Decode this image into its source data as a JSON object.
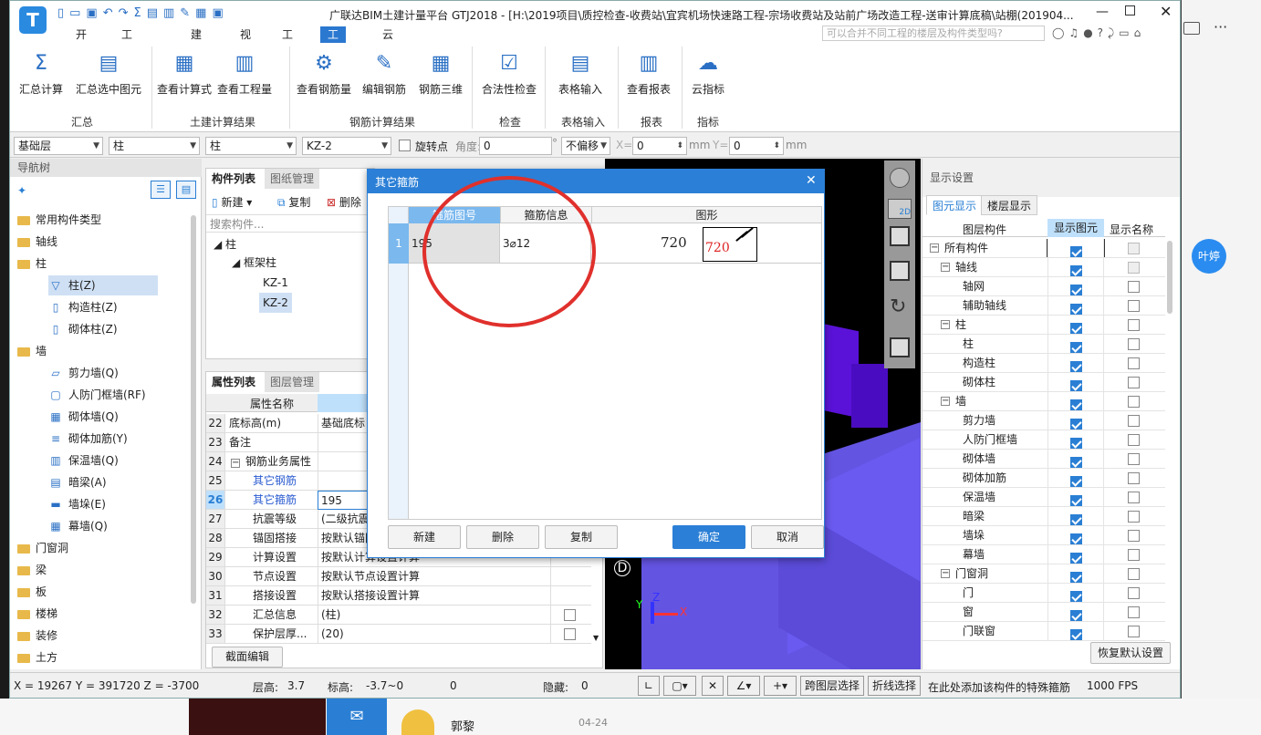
{
  "window": {
    "title": "广联达BIM土建计量平台 GTJ2018 - [H:\\2019项目\\质控检查-收费站\\宜宾机场快速路工程-宗场收费站及站前广场改造工程-送审计算底稿\\站棚(201904..."
  },
  "menu": {
    "tabs": [
      "开始",
      "工程设置",
      "建模",
      "视图",
      "工具",
      "工程量",
      "云应用"
    ],
    "active": 5,
    "search_placeholder": "可以合并不同工程的楼层及构件类型吗?"
  },
  "ribbon": {
    "buttons": [
      "汇总计算",
      "汇总选中图元",
      "查看计算式",
      "查看工程量",
      "查看钢筋量",
      "编辑钢筋",
      "钢筋三维",
      "合法性检查",
      "表格输入",
      "查看报表",
      "云指标"
    ],
    "groups": [
      "汇总",
      "土建计算结果",
      "钢筋计算结果",
      "检查",
      "表格输入",
      "报表",
      "指标"
    ]
  },
  "toolbar": {
    "floor": "基础层",
    "type1": "柱",
    "type2": "柱",
    "comp": "KZ-2",
    "rotate_label": "旋转点",
    "angle_label": "角度:",
    "angle_val": "0",
    "deg": "°",
    "offset": "不偏移",
    "x_label": "X=",
    "x_val": "0",
    "mm1": "mm",
    "y_label": "Y=",
    "y_val": "0",
    "mm2": "mm"
  },
  "nav": {
    "title": "导航树",
    "items": [
      "常用构件类型",
      "轴线",
      "柱",
      "柱(Z)",
      "构造柱(Z)",
      "砌体柱(Z)",
      "墙",
      "剪力墙(Q)",
      "人防门框墙(RF)",
      "砌体墙(Q)",
      "砌体加筋(Y)",
      "保温墙(Q)",
      "暗梁(A)",
      "墙垛(E)",
      "幕墙(Q)",
      "门窗洞",
      "梁",
      "板",
      "楼梯",
      "装修",
      "土方"
    ]
  },
  "complist": {
    "tabs": [
      "构件列表",
      "图纸管理"
    ],
    "new": "新建",
    "copy": "复制",
    "del": "删除",
    "search": "搜索构件...",
    "tree": [
      "柱",
      "框架柱",
      "KZ-1",
      "KZ-2"
    ]
  },
  "props": {
    "tabs": [
      "属性列表",
      "图层管理"
    ],
    "header": "属性名称",
    "rows": [
      [
        "22",
        "底标高(m)",
        "基础底标"
      ],
      [
        "23",
        "备注",
        ""
      ],
      [
        "24",
        "钢筋业务属性",
        ""
      ],
      [
        "25",
        "其它钢筋",
        ""
      ],
      [
        "26",
        "其它箍筋",
        "195"
      ],
      [
        "27",
        "抗震等级",
        "(二级抗震"
      ],
      [
        "28",
        "锚固搭接",
        "按默认锚固"
      ],
      [
        "29",
        "计算设置",
        "按默认计算设置计算"
      ],
      [
        "30",
        "节点设置",
        "按默认节点设置计算"
      ],
      [
        "31",
        "搭接设置",
        "按默认搭接设置计算"
      ],
      [
        "32",
        "汇总信息",
        "(柱)"
      ],
      [
        "33",
        "保护层厚...",
        "(20)"
      ]
    ],
    "section_btn": "截面编辑"
  },
  "dialog": {
    "title": "其它箍筋",
    "headers": [
      "箍筋图号",
      "箍筋信息",
      "图形"
    ],
    "row": {
      "no": "1",
      "fig": "195",
      "info": "3⌀12",
      "len": "720",
      "shape_len": "720"
    },
    "buttons": [
      "新建",
      "删除",
      "复制",
      "确定",
      "取消"
    ]
  },
  "display": {
    "title": "显示设置",
    "tabs": [
      "图元显示",
      "楼层显示"
    ],
    "headers": [
      "图层构件",
      "显示图元",
      "显示名称"
    ],
    "rows": [
      [
        "所有构件",
        0,
        true,
        false
      ],
      [
        "轴线",
        1,
        true,
        false
      ],
      [
        "轴网",
        2,
        true,
        false
      ],
      [
        "辅助轴线",
        2,
        true,
        false
      ],
      [
        "柱",
        1,
        true,
        false
      ],
      [
        "柱",
        2,
        true,
        false
      ],
      [
        "构造柱",
        2,
        true,
        false
      ],
      [
        "砌体柱",
        2,
        true,
        false
      ],
      [
        "墙",
        1,
        true,
        false
      ],
      [
        "剪力墙",
        2,
        true,
        false
      ],
      [
        "人防门框墙",
        2,
        true,
        false
      ],
      [
        "砌体墙",
        2,
        true,
        false
      ],
      [
        "砌体加筋",
        2,
        true,
        false
      ],
      [
        "保温墙",
        2,
        true,
        false
      ],
      [
        "暗梁",
        2,
        true,
        false
      ],
      [
        "墙垛",
        2,
        true,
        false
      ],
      [
        "幕墙",
        2,
        true,
        false
      ],
      [
        "门窗洞",
        1,
        true,
        false
      ],
      [
        "门",
        2,
        true,
        false
      ],
      [
        "窗",
        2,
        true,
        false
      ],
      [
        "门联窗",
        2,
        true,
        false
      ]
    ],
    "reset": "恢复默认设置"
  },
  "view3d": {
    "btn2d": "2D",
    "d_label": "D"
  },
  "status": {
    "coords": "X = 19267 Y = 391720 Z = -3700",
    "floor_h_label": "层高:",
    "floor_h": "3.7",
    "elev_label": "标高:",
    "elev": "-3.7~0",
    "zero": "0",
    "hidden_label": "隐藏:",
    "hidden": "0",
    "cross_floor": "跨图层选择",
    "polyline": "折线选择",
    "hint": "在此处添加该构件的特殊箍筋",
    "fps": "1000 FPS"
  },
  "background": {
    "user_badge": "叶婷",
    "chat_name": "郭黎",
    "chat_date": "04-24"
  },
  "colors": {
    "accent": "#2a7fd4",
    "ribbon_active": "#2b78d0",
    "purple": "#6a50e8",
    "red_circle": "#e0302c"
  }
}
